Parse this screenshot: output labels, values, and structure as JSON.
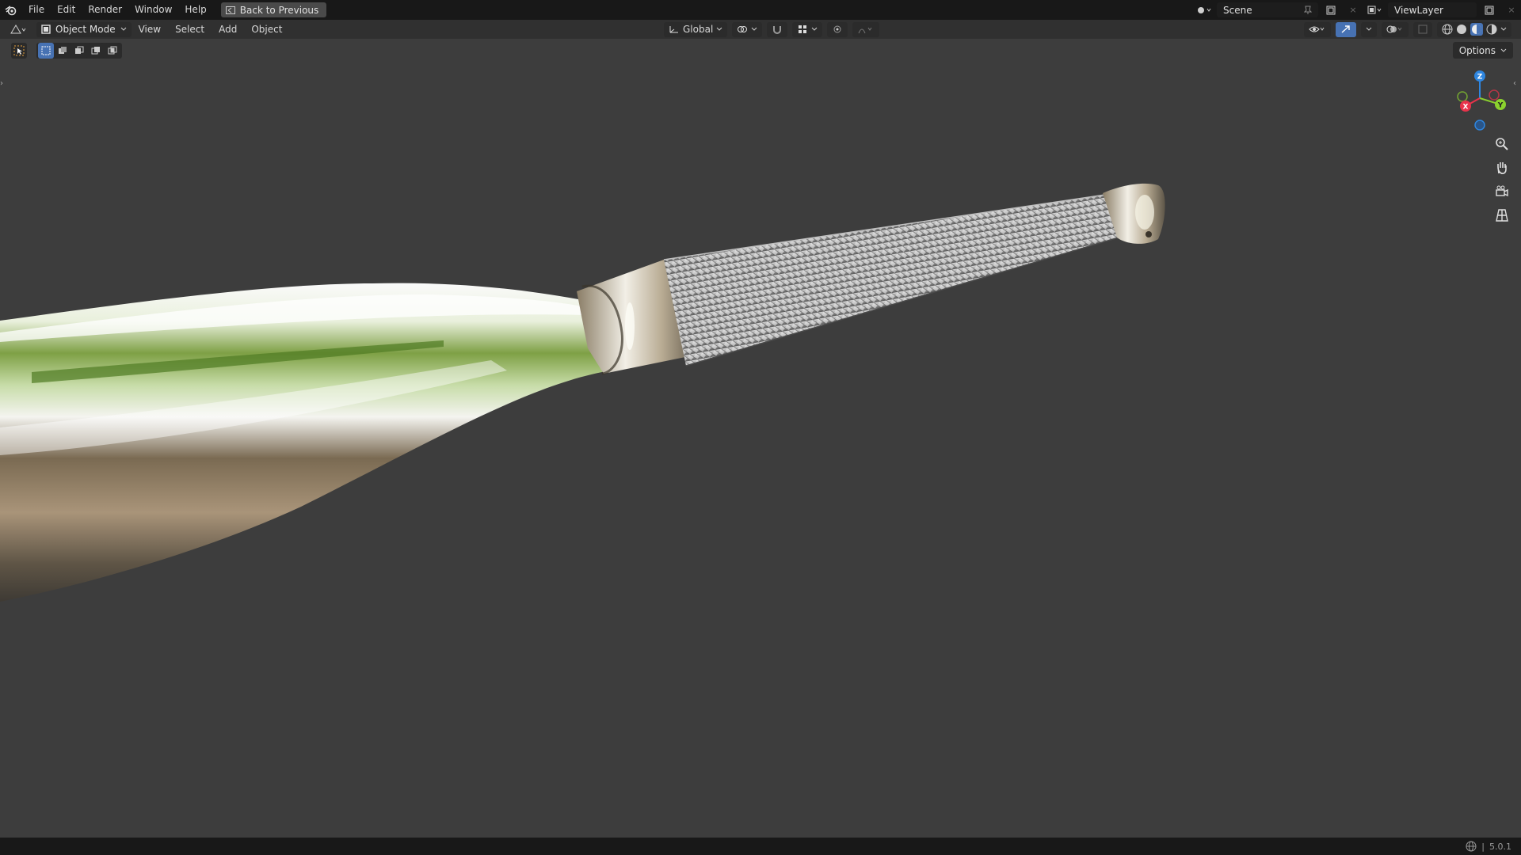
{
  "topbar": {
    "menus": [
      "File",
      "Edit",
      "Render",
      "Window",
      "Help"
    ],
    "back_button": "Back to Previous",
    "scene_name": "Scene",
    "view_layer": "ViewLayer"
  },
  "header": {
    "mode": "Object Mode",
    "menus": [
      "View",
      "Select",
      "Add",
      "Object"
    ],
    "orientation": "Global"
  },
  "options_label": "Options",
  "gizmo": {
    "z_label": "Z",
    "y_label": "Y",
    "x_label": "X",
    "x_color": "#e8334a",
    "y_color": "#8bd12e",
    "z_color": "#2e86e0"
  },
  "nav_buttons": [
    "zoom-icon",
    "hand-pan-icon",
    "camera-icon",
    "grid-perspective-icon"
  ],
  "status": {
    "version": "5.0.1"
  },
  "colors": {
    "background": "#3d3d3d",
    "topbar": "#181818",
    "header": "#303030",
    "accent": "#4772b3"
  }
}
